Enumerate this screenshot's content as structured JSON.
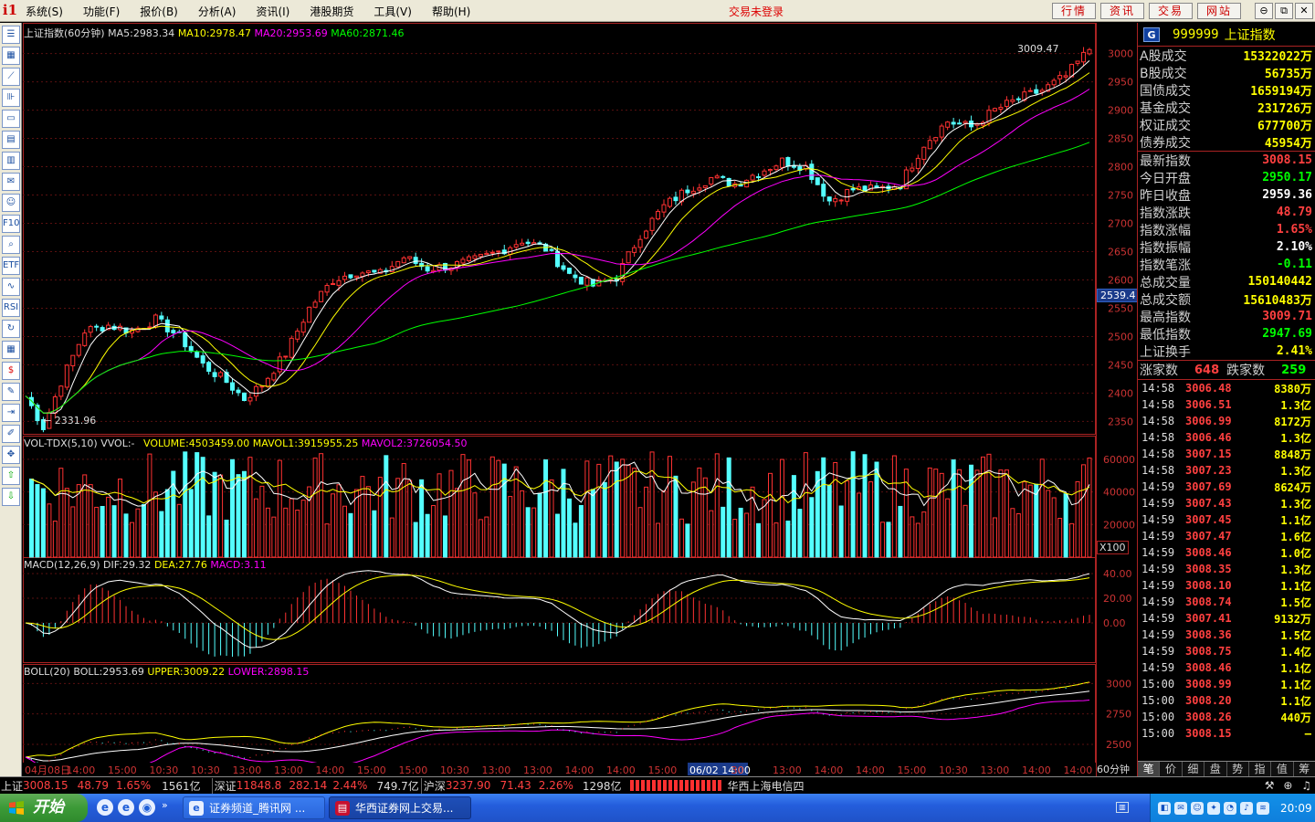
{
  "app": {
    "logo_text": "i1",
    "menu": [
      "系统(S)",
      "功能(F)",
      "报价(B)",
      "分析(A)",
      "资讯(I)",
      "港股期货",
      "工具(V)",
      "帮助(H)"
    ],
    "login_status": "交易未登录",
    "top_buttons": [
      "行情",
      "资讯",
      "交易",
      "网站"
    ],
    "window_controls": [
      "⊖",
      "⧉",
      "✕"
    ]
  },
  "toolbar_icons": [
    "list-icon",
    "grid-icon",
    "line-chart-icon",
    "candle-icon",
    "window-icon",
    "table-icon",
    "report-icon",
    "mail-icon",
    "people-icon",
    "f10-icon",
    "search-icon",
    "etf-icon",
    "wave-icon",
    "rsi-icon",
    "refresh-icon",
    "calendar-icon",
    "money-icon",
    "wrench-icon",
    "export-icon",
    "pencil-icon",
    "move-icon",
    "up-arrow-icon",
    "down-arrow-icon"
  ],
  "toolbar_labels": [
    "☰",
    "▦",
    "⟋",
    "⊪",
    "▭",
    "▤",
    "▥",
    "✉",
    "☺",
    "F10",
    "⌕",
    "ETF",
    "∿",
    "RSI",
    "↻",
    "▦",
    "$",
    "✎",
    "⇥",
    "✐",
    "✥",
    "⇧",
    "⇩"
  ],
  "main_chart": {
    "label": "上证指数(60分钟)",
    "ma5": "MA5:2983.34",
    "ma10": "MA10:2978.47",
    "ma20": "MA20:2953.69",
    "ma60": "MA60:2871.46",
    "high_label": "3009.47",
    "low_label": "← 2331.96",
    "y_ticks": [
      "3000",
      "2950",
      "2900",
      "2850",
      "2800",
      "2750",
      "2700",
      "2650",
      "2600",
      "2550",
      "2500",
      "2450",
      "2400",
      "2350"
    ],
    "cursor_price": "2539.4"
  },
  "vol_panel": {
    "label": "VOL-TDX(5,10)",
    "vvol": "VVOL:-",
    "volume": "VOLUME:4503459.00",
    "mavol1": "MAVOL1:3915955.25",
    "mavol2": "MAVOL2:3726054.50",
    "y_ticks": [
      "60000",
      "40000",
      "20000"
    ],
    "unit": "X100"
  },
  "macd_panel": {
    "label": "MACD(12,26,9)",
    "dif": "DIF:29.32",
    "dea": "DEA:27.76",
    "macd": "MACD:3.11",
    "y_ticks": [
      "40.00",
      "20.00",
      "0.00"
    ]
  },
  "boll_panel": {
    "label": "BOLL(20)",
    "boll": "BOLL:2953.69",
    "upper": "UPPER:3009.22",
    "lower": "LOWER:2898.15",
    "y_ticks": [
      "3000",
      "2750",
      "2500"
    ]
  },
  "x_axis": {
    "labels": [
      "04月08日",
      "14:00",
      "15:00",
      "10:30",
      "10:30",
      "13:00",
      "13:00",
      "14:00",
      "15:00",
      "15:00",
      "10:30",
      "13:00",
      "13:00",
      "14:00",
      "14:00",
      "15:00",
      "06/02 14:00",
      "30",
      "13:00",
      "14:00",
      "14:00",
      "15:00",
      "10:30",
      "13:00",
      "14:00",
      "14:00"
    ],
    "period": "60分钟"
  },
  "chart_data": {
    "type": "candlestick",
    "title": "上证指数(60分钟)",
    "price_axis_range": [
      2331.96,
      3009.71
    ],
    "series_summary": {
      "last": 3008.15,
      "period_high": 3009.47,
      "period_low": 2331.96,
      "ma5": 2983.34,
      "ma10": 2978.47,
      "ma20": 2953.69,
      "ma60": 2871.46
    },
    "approx_close_path": [
      [
        0,
        2395
      ],
      [
        3,
        2340
      ],
      [
        6,
        2420
      ],
      [
        10,
        2510
      ],
      [
        14,
        2520
      ],
      [
        18,
        2510
      ],
      [
        22,
        2530
      ],
      [
        26,
        2500
      ],
      [
        30,
        2450
      ],
      [
        34,
        2420
      ],
      [
        37,
        2390
      ],
      [
        40,
        2415
      ],
      [
        44,
        2470
      ],
      [
        48,
        2550
      ],
      [
        52,
        2600
      ],
      [
        56,
        2615
      ],
      [
        60,
        2610
      ],
      [
        64,
        2640
      ],
      [
        68,
        2620
      ],
      [
        72,
        2625
      ],
      [
        76,
        2635
      ],
      [
        80,
        2650
      ],
      [
        84,
        2670
      ],
      [
        88,
        2655
      ],
      [
        92,
        2610
      ],
      [
        96,
        2590
      ],
      [
        100,
        2605
      ],
      [
        104,
        2680
      ],
      [
        108,
        2730
      ],
      [
        112,
        2760
      ],
      [
        116,
        2780
      ],
      [
        120,
        2770
      ],
      [
        124,
        2790
      ],
      [
        128,
        2810
      ],
      [
        132,
        2800
      ],
      [
        136,
        2740
      ],
      [
        140,
        2760
      ],
      [
        144,
        2760
      ],
      [
        148,
        2770
      ],
      [
        152,
        2840
      ],
      [
        156,
        2880
      ],
      [
        160,
        2870
      ],
      [
        164,
        2900
      ],
      [
        168,
        2920
      ],
      [
        172,
        2935
      ],
      [
        176,
        2960
      ],
      [
        180,
        3008
      ]
    ]
  },
  "quote_panel": {
    "badge": "G",
    "code": "999999",
    "name": "上证指数",
    "stats": [
      {
        "label": "A股成交",
        "value": "15322022万",
        "color": "#ffff00"
      },
      {
        "label": "B股成交",
        "value": "56735万",
        "color": "#ffff00"
      },
      {
        "label": "国债成交",
        "value": "1659194万",
        "color": "#ffff00"
      },
      {
        "label": "基金成交",
        "value": "231726万",
        "color": "#ffff00"
      },
      {
        "label": "权证成交",
        "value": "677700万",
        "color": "#ffff00"
      },
      {
        "label": "债券成交",
        "value": "45954万",
        "color": "#ffff00"
      }
    ],
    "index_stats": [
      {
        "label": "最新指数",
        "value": "3008.15",
        "color": "#ff4040"
      },
      {
        "label": "今日开盘",
        "value": "2950.17",
        "color": "#00ff00"
      },
      {
        "label": "昨日收盘",
        "value": "2959.36",
        "color": "#ffffff"
      },
      {
        "label": "指数涨跌",
        "value": "48.79",
        "color": "#ff4040"
      },
      {
        "label": "指数涨幅",
        "value": "1.65%",
        "color": "#ff4040"
      },
      {
        "label": "指数振幅",
        "value": "2.10%",
        "color": "#ffffff"
      },
      {
        "label": "指数笔涨",
        "value": "-0.11",
        "color": "#00ff00"
      },
      {
        "label": "总成交量",
        "value": "150140442",
        "color": "#ffff00"
      },
      {
        "label": "总成交额",
        "value": "15610483万",
        "color": "#ffff00"
      },
      {
        "label": "最高指数",
        "value": "3009.71",
        "color": "#ff4040"
      },
      {
        "label": "最低指数",
        "value": "2947.69",
        "color": "#00ff00"
      },
      {
        "label": "上证换手",
        "value": "2.41%",
        "color": "#ffff00"
      }
    ],
    "advance_label": "涨家数",
    "advance_value": "648",
    "decline_label": "跌家数",
    "decline_value": "259",
    "ticks": [
      {
        "time": "14:58",
        "price": "3006.48",
        "vol": "8380万"
      },
      {
        "time": "14:58",
        "price": "3006.51",
        "vol": "1.3亿"
      },
      {
        "time": "14:58",
        "price": "3006.99",
        "vol": "8172万"
      },
      {
        "time": "14:58",
        "price": "3006.46",
        "vol": "1.3亿"
      },
      {
        "time": "14:58",
        "price": "3007.15",
        "vol": "8848万"
      },
      {
        "time": "14:58",
        "price": "3007.23",
        "vol": "1.3亿"
      },
      {
        "time": "14:59",
        "price": "3007.69",
        "vol": "8624万"
      },
      {
        "time": "14:59",
        "price": "3007.43",
        "vol": "1.3亿"
      },
      {
        "time": "14:59",
        "price": "3007.45",
        "vol": "1.1亿"
      },
      {
        "time": "14:59",
        "price": "3007.47",
        "vol": "1.6亿"
      },
      {
        "time": "14:59",
        "price": "3008.46",
        "vol": "1.0亿"
      },
      {
        "time": "14:59",
        "price": "3008.35",
        "vol": "1.3亿"
      },
      {
        "time": "14:59",
        "price": "3008.10",
        "vol": "1.1亿"
      },
      {
        "time": "14:59",
        "price": "3008.74",
        "vol": "1.5亿"
      },
      {
        "time": "14:59",
        "price": "3007.41",
        "vol": "9132万"
      },
      {
        "time": "14:59",
        "price": "3008.36",
        "vol": "1.5亿"
      },
      {
        "time": "14:59",
        "price": "3008.75",
        "vol": "1.4亿"
      },
      {
        "time": "14:59",
        "price": "3008.46",
        "vol": "1.1亿"
      },
      {
        "time": "15:00",
        "price": "3008.99",
        "vol": "1.1亿"
      },
      {
        "time": "15:00",
        "price": "3008.20",
        "vol": "1.1亿"
      },
      {
        "time": "15:00",
        "price": "3008.26",
        "vol": "440万"
      },
      {
        "time": "15:00",
        "price": "3008.15",
        "vol": "—"
      }
    ],
    "tabs": [
      "笔",
      "价",
      "细",
      "盘",
      "势",
      "指",
      "值",
      "筹"
    ]
  },
  "status_bar": {
    "sh_label": "上证",
    "sh_value": "3008.15",
    "sh_change": "48.79",
    "sh_pct": "1.65%",
    "sh_amt": "1561亿",
    "sz_label": "深证",
    "sz_value": "11848.8",
    "sz_change": "282.14",
    "sz_pct": "2.44%",
    "sz_amt": "749.7亿",
    "hs_label": "沪深",
    "hs_value": "3237.90",
    "hs_change": "71.43",
    "hs_pct": "2.26%",
    "hs_amt": "1298亿",
    "server": "华西上海电信四"
  },
  "taskbar": {
    "start": "开始",
    "quick_launch": [
      "e",
      "e",
      "◉"
    ],
    "tasks": [
      "证券频道_腾讯网 ...",
      "华西证券网上交易..."
    ],
    "clock": "20:09"
  }
}
